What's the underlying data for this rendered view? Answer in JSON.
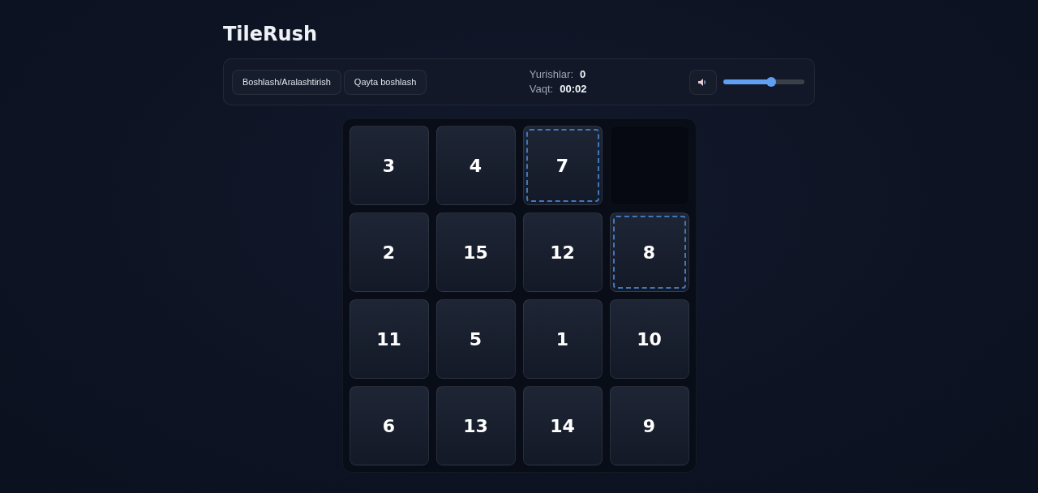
{
  "title": "TileRush",
  "toolbar": {
    "buttons": [
      {
        "label": "Boshlash/Aralashtirish"
      },
      {
        "label": "Qayta boshlash"
      }
    ],
    "stats": [
      {
        "label": "Yurishlar:",
        "value": "0"
      },
      {
        "label": "Vaqt:",
        "value": "00:02"
      }
    ],
    "volume": {
      "muted": false,
      "level": 0.59
    }
  },
  "board": {
    "tiles": [
      {
        "kind": "number",
        "label": "3",
        "movable": false
      },
      {
        "kind": "number",
        "label": "4",
        "movable": false
      },
      {
        "kind": "number",
        "label": "7",
        "movable": true
      },
      {
        "kind": "empty"
      },
      {
        "kind": "number",
        "label": "2",
        "movable": false
      },
      {
        "kind": "number",
        "label": "15",
        "movable": false
      },
      {
        "kind": "number",
        "label": "12",
        "movable": false
      },
      {
        "kind": "number",
        "label": "8",
        "movable": true
      },
      {
        "kind": "number",
        "label": "11",
        "movable": false
      },
      {
        "kind": "number",
        "label": "5",
        "movable": false
      },
      {
        "kind": "number",
        "label": "1",
        "movable": false
      },
      {
        "kind": "number",
        "label": "10",
        "movable": false
      },
      {
        "kind": "number",
        "label": "6",
        "movable": false
      },
      {
        "kind": "number",
        "label": "13",
        "movable": false
      },
      {
        "kind": "number",
        "label": "14",
        "movable": false
      },
      {
        "kind": "number",
        "label": "9",
        "movable": false
      }
    ]
  }
}
